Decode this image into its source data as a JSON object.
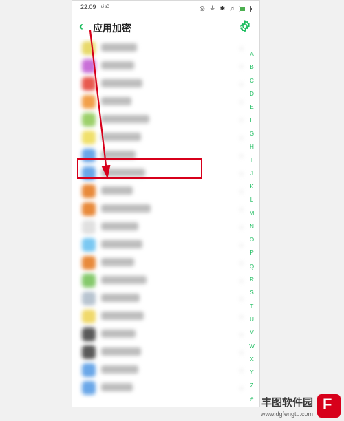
{
  "status": {
    "time": "22:09",
    "signal": "ᵘⁱ ⁴ᴳ",
    "right_icons": "◎ ⏚ ✱ ♫",
    "battery_pct": 50
  },
  "nav": {
    "back_glyph": "‹",
    "title": "应用加密",
    "settings_name": "settings"
  },
  "rows": [
    {
      "color": "#e8d96b",
      "name_w": 52
    },
    {
      "color": "#c96fd8",
      "name_w": 48
    },
    {
      "color": "#e85a4f",
      "name_w": 60
    },
    {
      "color": "#f2a04a",
      "name_w": 44
    },
    {
      "color": "#9cd06a",
      "name_w": 70
    },
    {
      "color": "#f0e06b",
      "name_w": 58
    },
    {
      "color": "#6aa7e8",
      "name_w": 50
    },
    {
      "color": "#6aa7e8",
      "name_w": 64
    },
    {
      "color": "#e88a3b",
      "name_w": 46
    },
    {
      "color": "#e88a3b",
      "name_w": 72
    },
    {
      "color": "#e0e0e0",
      "name_w": 54
    },
    {
      "color": "#7ac8f2",
      "name_w": 60
    },
    {
      "color": "#e88a3b",
      "name_w": 48
    },
    {
      "color": "#85c96b",
      "name_w": 66
    },
    {
      "color": "#b8c4d0",
      "name_w": 56
    },
    {
      "color": "#f0d96b",
      "name_w": 62
    },
    {
      "color": "#5a5a5a",
      "name_w": 50
    },
    {
      "color": "#5a5a5a",
      "name_w": 58
    },
    {
      "color": "#6aa7e8",
      "name_w": 54
    },
    {
      "color": "#6aa7e8",
      "name_w": 46
    }
  ],
  "index_letters": [
    "A",
    "B",
    "C",
    "D",
    "E",
    "F",
    "G",
    "H",
    "I",
    "J",
    "K",
    "L",
    "M",
    "N",
    "O",
    "P",
    "Q",
    "R",
    "S",
    "T",
    "U",
    "V",
    "W",
    "X",
    "Y",
    "Z",
    "#"
  ],
  "chevron": "›",
  "highlight": {
    "row_index": 5
  },
  "watermark": {
    "brand": "丰图软件园",
    "url": "www.dgfengtu.com"
  }
}
